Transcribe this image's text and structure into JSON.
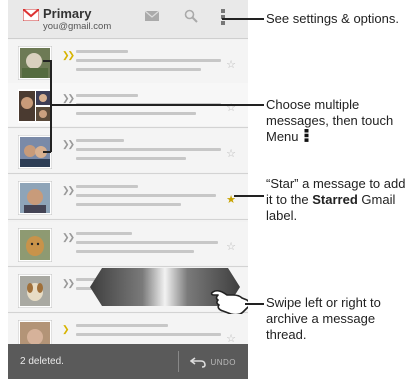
{
  "header": {
    "folder": "Primary",
    "account": "you@gmail.com"
  },
  "icons": {
    "compose": "compose-icon",
    "search": "search-icon",
    "menu": "menu-icon",
    "star": "star-icon",
    "undo": "undo-icon",
    "hand": "hand-pointer-icon"
  },
  "bottom_bar": {
    "status": "2 deleted.",
    "undo_label": "UNDO"
  },
  "callouts": {
    "settings": "See settings & options.",
    "multi_select": "Choose multiple messages, then touch Menu",
    "star_before": "“Star” a message to add it to the",
    "star_bold": "Starred",
    "star_after": "Gmail label.",
    "swipe": "Swipe left or right to archive a message thread."
  },
  "colors": {
    "accent_star": "#c8a300",
    "bottom_bar": "#5a5a5a"
  },
  "messages": [
    {
      "starred": false,
      "checked": false
    },
    {
      "starred": false,
      "checked": false
    },
    {
      "starred": false,
      "checked": false
    },
    {
      "starred": true,
      "checked": false
    },
    {
      "starred": false,
      "checked": false
    },
    {
      "starred": false,
      "checked": false
    },
    {
      "starred": false,
      "checked": false
    }
  ]
}
